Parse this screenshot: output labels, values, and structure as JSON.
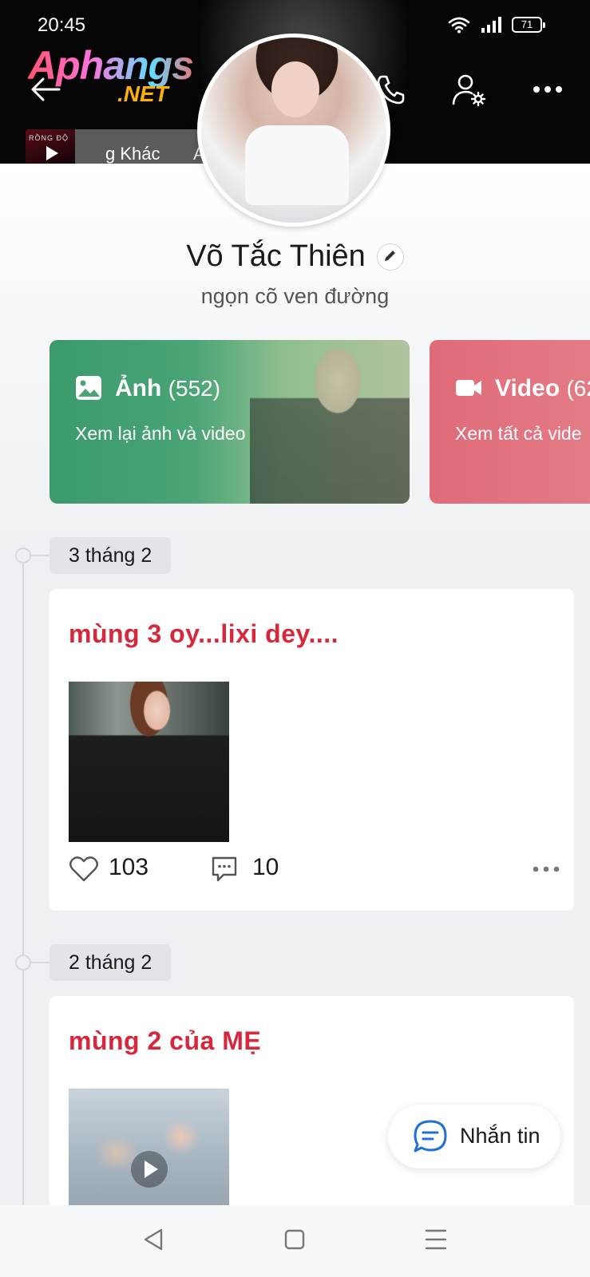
{
  "status_bar": {
    "time": "20:45",
    "battery": "71"
  },
  "header": {
    "logo_main": "Aphangs",
    "logo_sub": ".NET",
    "music": {
      "cover_text": "RỒNG ĐỘ",
      "title": "g Khác",
      "title_2": "Ai"
    }
  },
  "profile": {
    "name": "Võ Tắc Thiên",
    "status": "ngọn cõ ven đường"
  },
  "albums": [
    {
      "icon": "image-icon",
      "title": "Ảnh",
      "count": "(552)",
      "subtitle": "Xem lại ảnh và video",
      "color": "#3a9a6c"
    },
    {
      "icon": "video-camera-icon",
      "title": "Video",
      "count": "(62",
      "subtitle": "Xem tất cả vide",
      "color": "#e06a78"
    }
  ],
  "timeline": [
    {
      "date": "3 tháng 2",
      "text": "mùng 3 oy...lixi dey....",
      "likes": "103",
      "comments": "10",
      "media": "photo"
    },
    {
      "date": "2 tháng 2",
      "text": "mùng 2 của MẸ",
      "media": "video"
    }
  ],
  "message_button": {
    "label": "Nhắn tin"
  },
  "colors": {
    "accent_text": "#d8263b",
    "brand_blue": "#1e6fd9"
  }
}
